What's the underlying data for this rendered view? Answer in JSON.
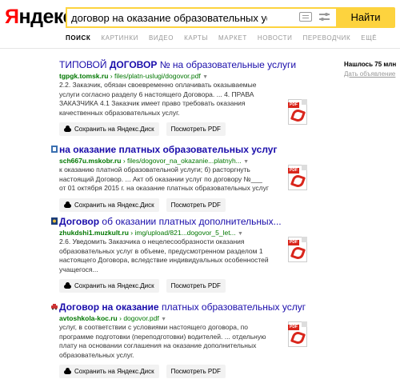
{
  "header": {
    "logo_first": "Я",
    "logo_rest": "ндекс",
    "search_value": "договор на оказание образовательных услуг mime:pdf",
    "find_label": "Найти"
  },
  "tabs": [
    "ПОИСК",
    "КАРТИНКИ",
    "ВИДЕО",
    "КАРТЫ",
    "МАРКЕТ",
    "НОВОСТИ",
    "ПЕРЕВОДЧИК",
    "ЕЩЁ"
  ],
  "sidebar": {
    "found": "Нашлось 75 млн",
    "ad_link": "Дать объявление"
  },
  "buttons": {
    "save": "Сохранить на Яндекс.Диск",
    "view": "Посмотреть PDF"
  },
  "pdf_icon": {
    "tag": "PDF"
  },
  "results": [
    {
      "title_pre": "ТИПОВОЙ ",
      "title_bold": "ДОГОВОР",
      "title_post": " № на образовательные услуги",
      "url_host": "tgpgk.tomsk.ru",
      "url_path": "files/platn-uslugi/dogovor.pdf",
      "snippet": "2.2. Заказчик, обязан своевременно оплачивать оказываемые услуги согласно разделу 6 настоящего Договора. ... 4. ПРАВА ЗАКАЗЧИКА 4.1 Заказчик имеет право требовать оказания качественных образовательных услуг."
    },
    {
      "title_pre": "",
      "title_bold": "на оказание платных образовательных услуг",
      "title_post": "",
      "url_host": "sch667u.mskobr.ru",
      "url_path": "files/dogovor_na_okazanie...platnyh...",
      "snippet": "к оказанию платной образовательной услуги; б) расторгнуть настоящий Договор. ... Акт об оказании услуг по договору №___ от 01 октября 2015 г. на оказание платных образовательных услуг"
    },
    {
      "title_pre": "",
      "title_bold": "Договор",
      "title_post": " об оказании платных дополнительных...",
      "url_host": "zhukdshi1.muzkult.ru",
      "url_path": "img/upload/821...dogovor_5_let...",
      "snippet": "2.6. Уведомить Заказчика о нецелесообразности оказания образовательных услуг в объеме, предусмотренном разделом 1 настоящего Договора, вследствие индивидуальных особенностей учащегося..."
    },
    {
      "title_pre": "",
      "title_bold": "Договор на оказание",
      "title_post": " платных образовательных услуг",
      "url_host": "avtoshkola-koc.ru",
      "url_path": "dogovor.pdf",
      "snippet": "услуг, в соответствии с условиями настоящего договора, по программе подготовки (переподготовки) водителей. ... отдельную плату на основании соглашения на оказание дополнительных образовательных услуг."
    }
  ]
}
